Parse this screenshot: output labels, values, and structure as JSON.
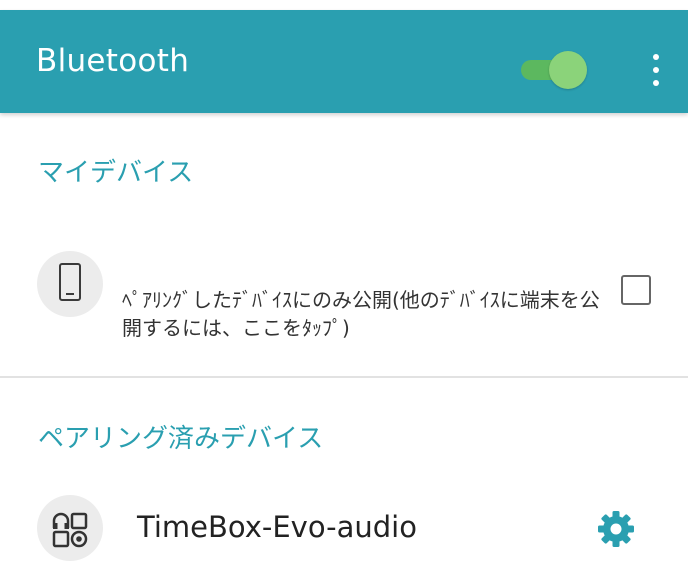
{
  "appbar": {
    "title": "Bluetooth",
    "toggle_on": true,
    "overflow_icon": "more-vert-icon",
    "bg_color": "#2a9fb0",
    "toggle_color": "#8bd37a"
  },
  "my_device": {
    "header": "マイデバイス",
    "icon": "phone-icon",
    "visibility_text": "ﾍﾟｱﾘﾝｸﾞしたﾃﾞﾊﾞｲｽにのみ公開(他のﾃﾞﾊﾞｲｽに端末を公開するには、ここをﾀｯﾌﾟ)",
    "checkbox_checked": false
  },
  "paired": {
    "header": "ペアリング済みデバイス",
    "devices": [
      {
        "name": "TimeBox-Evo-audio",
        "icon": "audio-device-icon",
        "settings_icon": "gear-icon"
      }
    ]
  }
}
